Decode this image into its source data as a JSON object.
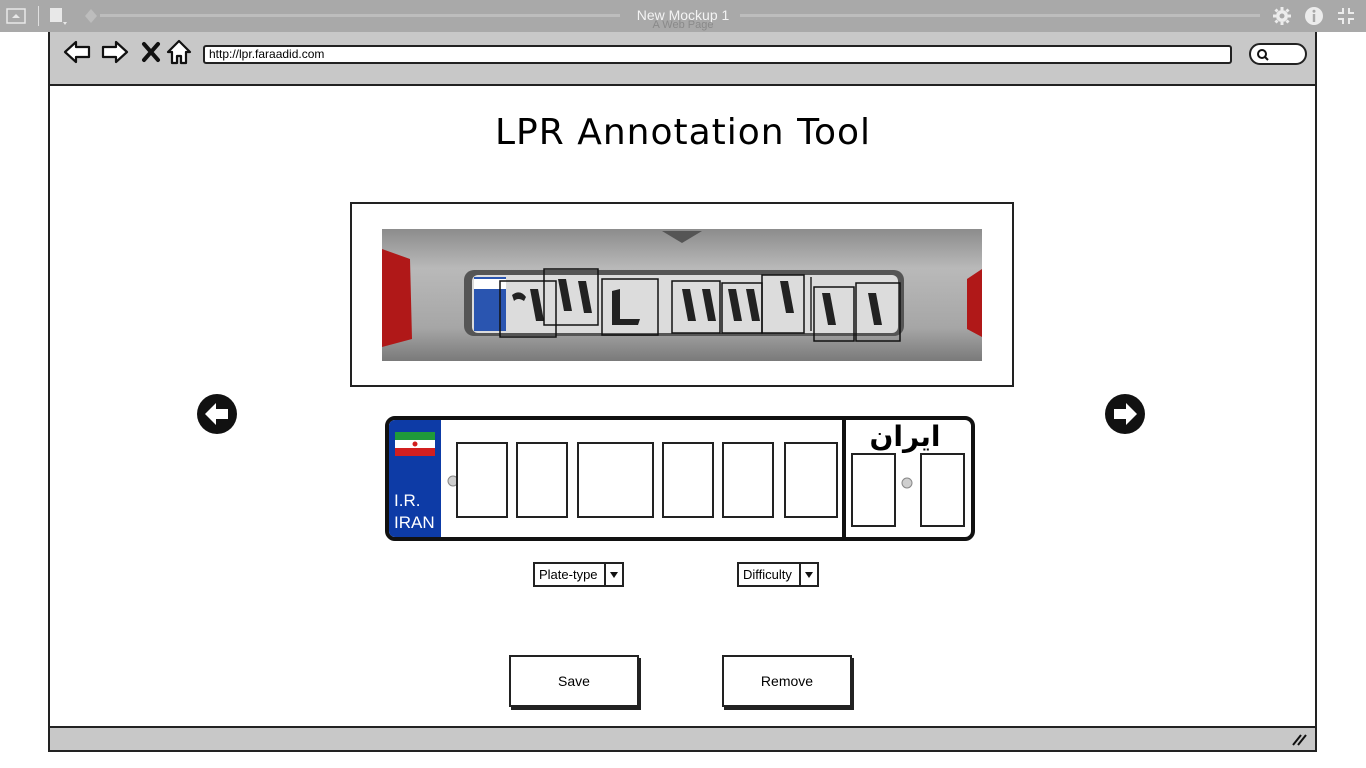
{
  "app": {
    "title": "New Mockup 1",
    "subtitle": "A Web Page"
  },
  "browser": {
    "url": "http://lpr.faraadid.com"
  },
  "page": {
    "title": "LPR Annotation Tool"
  },
  "plate_template": {
    "country_code_line1": "I.R.",
    "country_code_line2": "IRAN",
    "country_name": "ایران",
    "blue_color": "#0d3ba6"
  },
  "controls": {
    "plate_type_label": "Plate-type",
    "difficulty_label": "Difficulty",
    "save_label": "Save",
    "remove_label": "Remove"
  },
  "icons": {
    "prev": "arrow-left-circle-icon",
    "next": "arrow-right-circle-icon",
    "back": "back-arrow-icon",
    "forward": "forward-arrow-icon",
    "stop": "close-icon",
    "home": "home-icon",
    "search": "search-icon",
    "settings": "gear-icon",
    "info": "info-icon",
    "fullscreen": "collapse-icon"
  }
}
